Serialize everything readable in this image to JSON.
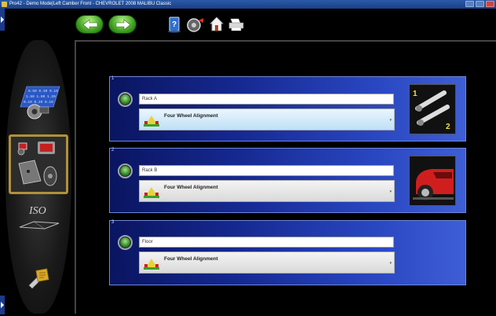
{
  "window": {
    "title": "Pro42 - Demo Mode|Left Camber Front - CHEVROLET 2008 MALIBU Classic"
  },
  "toolbar": {
    "back_icon": "arrow-left-icon",
    "forward_icon": "arrow-right-icon",
    "tools": [
      "help-icon",
      "print-icon",
      "home-icon",
      "printer-icon"
    ]
  },
  "leftnav": {
    "items": [
      {
        "name": "specifications-icon",
        "label": ""
      },
      {
        "name": "alignment-rack-icon",
        "label": "",
        "selected": true
      },
      {
        "name": "iso-icon",
        "label": "ISO"
      },
      {
        "name": "tools-icon",
        "label": ""
      }
    ]
  },
  "racks": [
    {
      "index": "1",
      "name": "Rack A",
      "mode": "Four Wheel Alignment",
      "active": true,
      "thumb": "two-heads-icon",
      "thumb_labels": [
        "1",
        "2"
      ]
    },
    {
      "index": "2",
      "name": "Rack B",
      "mode": "Four Wheel Alignment",
      "active": false,
      "thumb": "car-front-icon"
    },
    {
      "index": "3",
      "name": "Floor",
      "mode": "Four Wheel Alignment",
      "active": false
    }
  ],
  "colors": {
    "panel_dark": "#0a1560",
    "panel_light": "#3e5ed6",
    "nav_highlight": "#b0913a",
    "green_button": "#3fa11f"
  }
}
